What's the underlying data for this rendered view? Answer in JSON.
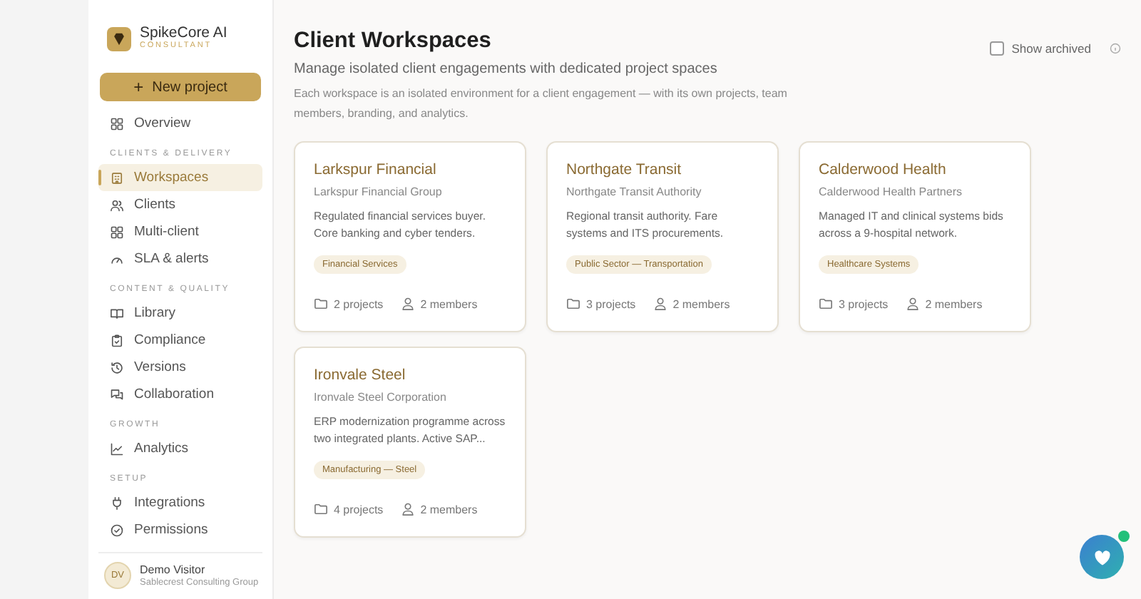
{
  "brand": {
    "name": "SpikeCore AI",
    "tagline": "CONSULTANT"
  },
  "new_project_button": {
    "label": "New project",
    "icon_text": "+"
  },
  "sidebar": {
    "groups": [
      {
        "items": [
          {
            "label": "Overview",
            "selected": false
          }
        ]
      },
      {
        "heading": "CLIENTS & DELIVERY",
        "items": [
          {
            "label": "Workspaces",
            "selected": true
          },
          {
            "label": "Clients",
            "selected": false
          },
          {
            "label": "Multi-client",
            "selected": false
          },
          {
            "label": "SLA & alerts",
            "selected": false
          }
        ]
      },
      {
        "heading": "CONTENT & QUALITY",
        "items": [
          {
            "label": "Library",
            "selected": false
          },
          {
            "label": "Compliance",
            "selected": false
          },
          {
            "label": "Versions",
            "selected": false
          },
          {
            "label": "Collaboration",
            "selected": false
          }
        ]
      },
      {
        "heading": "GROWTH",
        "items": [
          {
            "label": "Analytics",
            "selected": false
          }
        ]
      },
      {
        "heading": "SETUP",
        "items": [
          {
            "label": "Integrations",
            "selected": false
          },
          {
            "label": "Permissions",
            "selected": false
          }
        ]
      }
    ],
    "user": {
      "initials": "DV",
      "name": "Demo Visitor",
      "org": "Sablecrest Consulting Group"
    }
  },
  "page": {
    "title": "Client Workspaces",
    "subtitle": "Manage isolated client engagements with dedicated project spaces",
    "description": "Each workspace is an isolated environment for a client engagement — with its own projects, team members, branding, and analytics.",
    "show_archived": {
      "label": "Show archived",
      "checked": false
    }
  },
  "workspaces": [
    {
      "name": "Larkspur Financial",
      "org": "Larkspur Financial Group",
      "summary": "Regulated financial services buyer. Core banking and cyber tenders.",
      "tag": "Financial Services",
      "projects": "2 projects",
      "members": "2 members"
    },
    {
      "name": "Northgate Transit",
      "org": "Northgate Transit Authority",
      "summary": "Regional transit authority. Fare systems and ITS procurements.",
      "tag": "Public Sector — Transportation",
      "projects": "3 projects",
      "members": "2 members"
    },
    {
      "name": "Calderwood Health",
      "org": "Calderwood Health Partners",
      "summary": "Managed IT and clinical systems bids across a 9-hospital network.",
      "tag": "Healthcare Systems",
      "projects": "3 projects",
      "members": "2 members"
    },
    {
      "name": "Ironvale Steel",
      "org": "Ironvale Steel Corporation",
      "summary": "ERP modernization programme across two integrated plants. Active SAP...",
      "tag": "Manufacturing — Steel",
      "projects": "4 projects",
      "members": "2 members"
    }
  ],
  "chat": {
    "online": true
  }
}
